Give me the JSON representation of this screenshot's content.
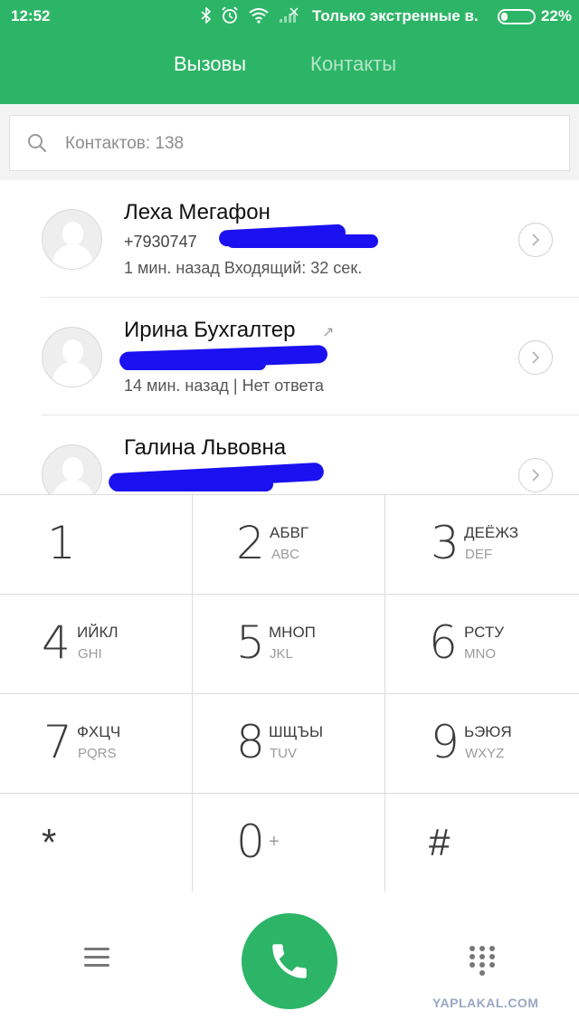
{
  "status_bar": {
    "time": "12:52",
    "carrier": "Только экстренные в.",
    "battery_percent": 22,
    "battery_text": "22%",
    "icons": [
      "bluetooth-icon",
      "alarm-icon",
      "wifi-icon",
      "no-signal-icon"
    ]
  },
  "tabs": [
    {
      "label": "Вызовы",
      "active": true
    },
    {
      "label": "Контакты",
      "active": false
    }
  ],
  "search": {
    "placeholder": "Контактов: 138"
  },
  "calls": [
    {
      "name": "Леха Мегафон",
      "number": "+7930747",
      "detail": "1 мин. назад Входящий: 32 сек.",
      "outgoing": false
    },
    {
      "name": "Ирина Бухгалтер",
      "number": "",
      "detail": "14 мин. назад | Нет ответа",
      "outgoing": true
    },
    {
      "name": "Галина Львовна",
      "number": "",
      "detail": "",
      "outgoing": false
    }
  ],
  "dialpad": {
    "keys": [
      {
        "digit": "1",
        "cyr": "",
        "lat": ""
      },
      {
        "digit": "2",
        "cyr": "АБВГ",
        "lat": "ABC"
      },
      {
        "digit": "3",
        "cyr": "ДЕЁЖЗ",
        "lat": "DEF"
      },
      {
        "digit": "4",
        "cyr": "ИЙКЛ",
        "lat": "GHI"
      },
      {
        "digit": "5",
        "cyr": "МНОП",
        "lat": "JKL"
      },
      {
        "digit": "6",
        "cyr": "РСТУ",
        "lat": "MNO"
      },
      {
        "digit": "7",
        "cyr": "ФХЦЧ",
        "lat": "PQRS"
      },
      {
        "digit": "8",
        "cyr": "ШЩЪЫ",
        "lat": "TUV"
      },
      {
        "digit": "9",
        "cyr": "ЬЭЮЯ",
        "lat": "WXYZ"
      },
      {
        "digit": "*",
        "cyr": "",
        "lat": ""
      },
      {
        "digit": "0",
        "cyr": "",
        "lat": "",
        "extra": "+"
      },
      {
        "digit": "#",
        "cyr": "",
        "lat": ""
      }
    ]
  },
  "bottom_bar": {
    "menu_icon": "menu-icon",
    "call_icon": "phone-icon",
    "dialpad_icon": "dialpad-grid-icon"
  },
  "watermark": "YAPLAKAL.COM",
  "colors": {
    "accent": "#2db567",
    "redaction": "#1a10f0"
  }
}
